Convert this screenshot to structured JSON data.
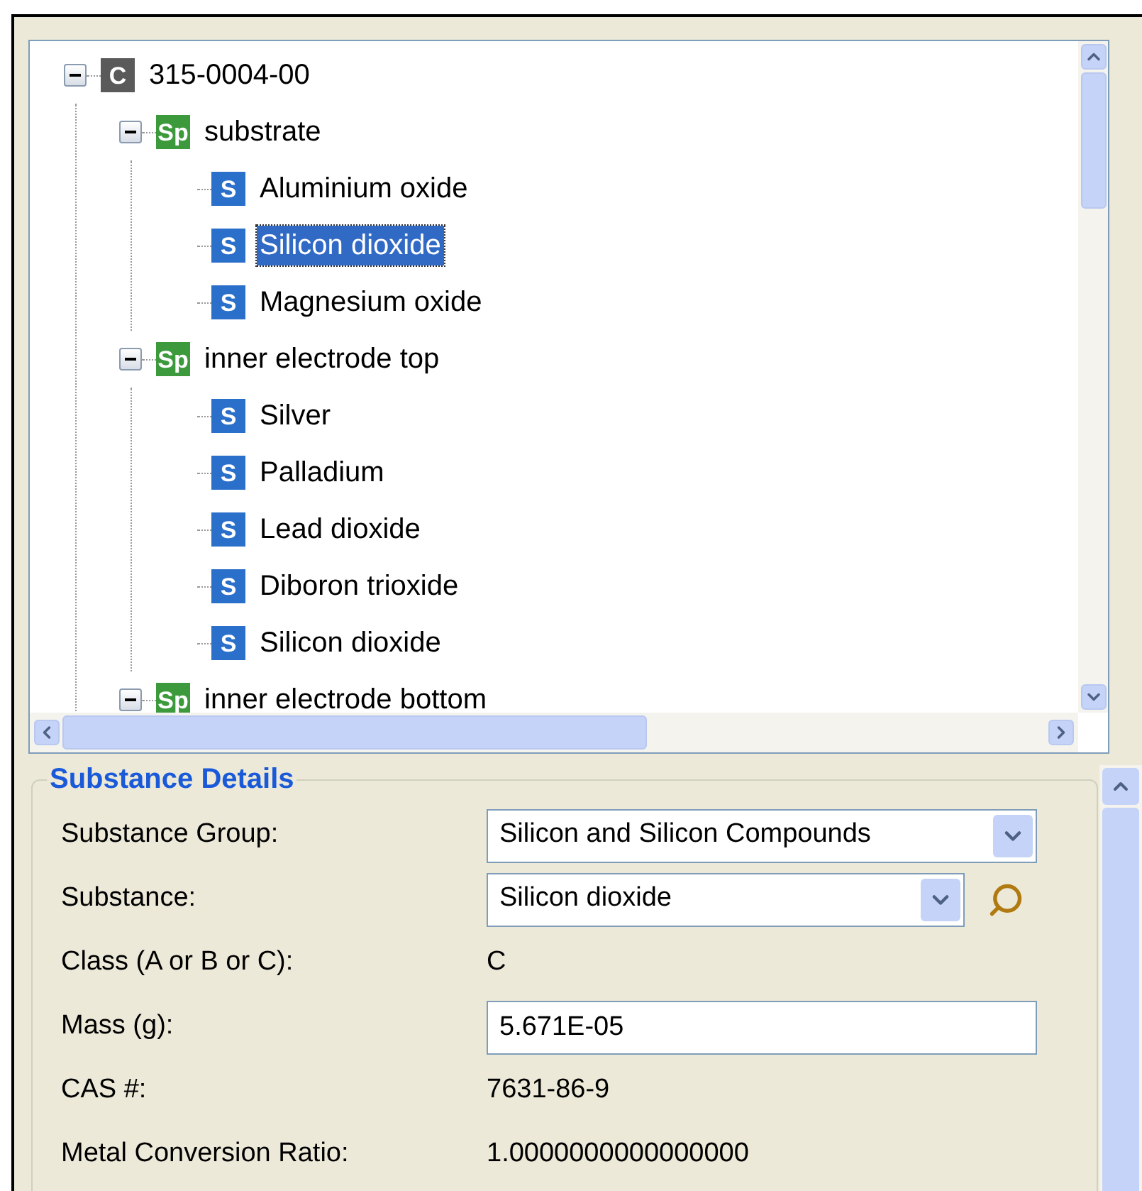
{
  "tree": [
    {
      "label": "315-0004-00",
      "kind": "component",
      "badge": "C",
      "expanded": true,
      "selected": false,
      "children": [
        {
          "label": "substrate",
          "kind": "part",
          "badge": "Sp",
          "expanded": true,
          "selected": false,
          "children": [
            {
              "label": "Aluminium oxide",
              "kind": "substance",
              "badge": "S",
              "selected": false
            },
            {
              "label": "Silicon dioxide",
              "kind": "substance",
              "badge": "S",
              "selected": true
            },
            {
              "label": "Magnesium oxide",
              "kind": "substance",
              "badge": "S",
              "selected": false
            }
          ]
        },
        {
          "label": "inner electrode top",
          "kind": "part",
          "badge": "Sp",
          "expanded": true,
          "selected": false,
          "children": [
            {
              "label": "Silver",
              "kind": "substance",
              "badge": "S",
              "selected": false
            },
            {
              "label": "Palladium",
              "kind": "substance",
              "badge": "S",
              "selected": false
            },
            {
              "label": "Lead dioxide",
              "kind": "substance",
              "badge": "S",
              "selected": false
            },
            {
              "label": "Diboron trioxide",
              "kind": "substance",
              "badge": "S",
              "selected": false
            },
            {
              "label": "Silicon dioxide",
              "kind": "substance",
              "badge": "S",
              "selected": false
            }
          ]
        },
        {
          "label": "inner electrode bottom",
          "kind": "part",
          "badge": "Sp",
          "expanded": true,
          "selected": false
        }
      ]
    }
  ],
  "details": {
    "title": "Substance Details",
    "fields": [
      {
        "kind": "combo",
        "label": "Substance Group:",
        "value": "Silicon and Silicon Compounds",
        "search": false
      },
      {
        "kind": "combo",
        "label": "Substance:",
        "value": "Silicon dioxide",
        "search": true
      },
      {
        "kind": "text",
        "label": "Class (A or B or C):",
        "value": "C"
      },
      {
        "kind": "input",
        "label": "Mass (g):",
        "value": "5.671E-05"
      },
      {
        "kind": "text",
        "label": "CAS #:",
        "value": "7631-86-9"
      },
      {
        "kind": "text",
        "label": "Metal Conversion Ratio:",
        "value": "1.0000000000000000"
      }
    ]
  }
}
